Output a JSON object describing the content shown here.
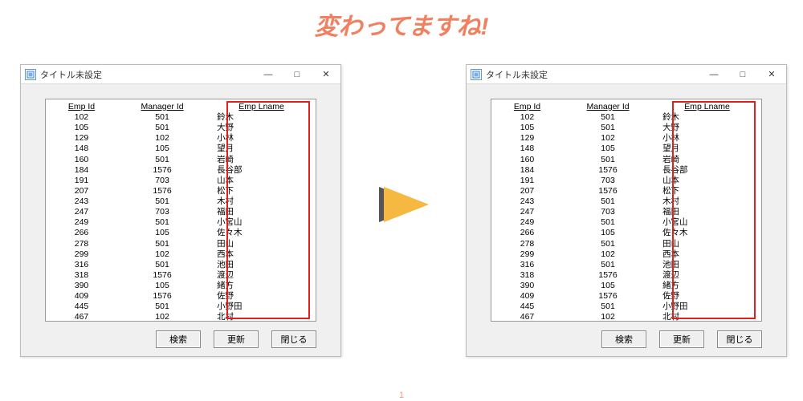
{
  "headline": "変わってますね!",
  "page_number": "1",
  "window": {
    "title": "タイトル未設定",
    "min": "—",
    "max": "□",
    "close": "✕"
  },
  "table": {
    "headers": {
      "emp_id": "Emp Id",
      "manager_id": "Manager Id",
      "emp_lname": "Emp Lname"
    },
    "rows": [
      {
        "emp_id": "102",
        "manager_id": "501",
        "emp_lname": "鈴木"
      },
      {
        "emp_id": "105",
        "manager_id": "501",
        "emp_lname": "大野"
      },
      {
        "emp_id": "129",
        "manager_id": "102",
        "emp_lname": "小林"
      },
      {
        "emp_id": "148",
        "manager_id": "105",
        "emp_lname": "望月"
      },
      {
        "emp_id": "160",
        "manager_id": "501",
        "emp_lname": "岩崎"
      },
      {
        "emp_id": "184",
        "manager_id": "1576",
        "emp_lname": "長谷部"
      },
      {
        "emp_id": "191",
        "manager_id": "703",
        "emp_lname": "山本"
      },
      {
        "emp_id": "207",
        "manager_id": "1576",
        "emp_lname": "松下"
      },
      {
        "emp_id": "243",
        "manager_id": "501",
        "emp_lname": "木村"
      },
      {
        "emp_id": "247",
        "manager_id": "703",
        "emp_lname": "福田"
      },
      {
        "emp_id": "249",
        "manager_id": "501",
        "emp_lname": "小宮山"
      },
      {
        "emp_id": "266",
        "manager_id": "105",
        "emp_lname": "佐々木"
      },
      {
        "emp_id": "278",
        "manager_id": "501",
        "emp_lname": "田山"
      },
      {
        "emp_id": "299",
        "manager_id": "102",
        "emp_lname": "西本"
      },
      {
        "emp_id": "316",
        "manager_id": "501",
        "emp_lname": "池田"
      },
      {
        "emp_id": "318",
        "manager_id": "1576",
        "emp_lname": "渡辺"
      },
      {
        "emp_id": "390",
        "manager_id": "105",
        "emp_lname": "緒方"
      },
      {
        "emp_id": "409",
        "manager_id": "1576",
        "emp_lname": "佐野"
      },
      {
        "emp_id": "445",
        "manager_id": "501",
        "emp_lname": "小野田"
      },
      {
        "emp_id": "467",
        "manager_id": "102",
        "emp_lname": "北村"
      }
    ]
  },
  "buttons": {
    "search": "検索",
    "update": "更新",
    "close": "閉じる"
  },
  "colors": {
    "accent": "#f08060",
    "highlight_border": "#e02020",
    "arrow_fill": "#f5b942",
    "arrow_shadow": "#555"
  }
}
